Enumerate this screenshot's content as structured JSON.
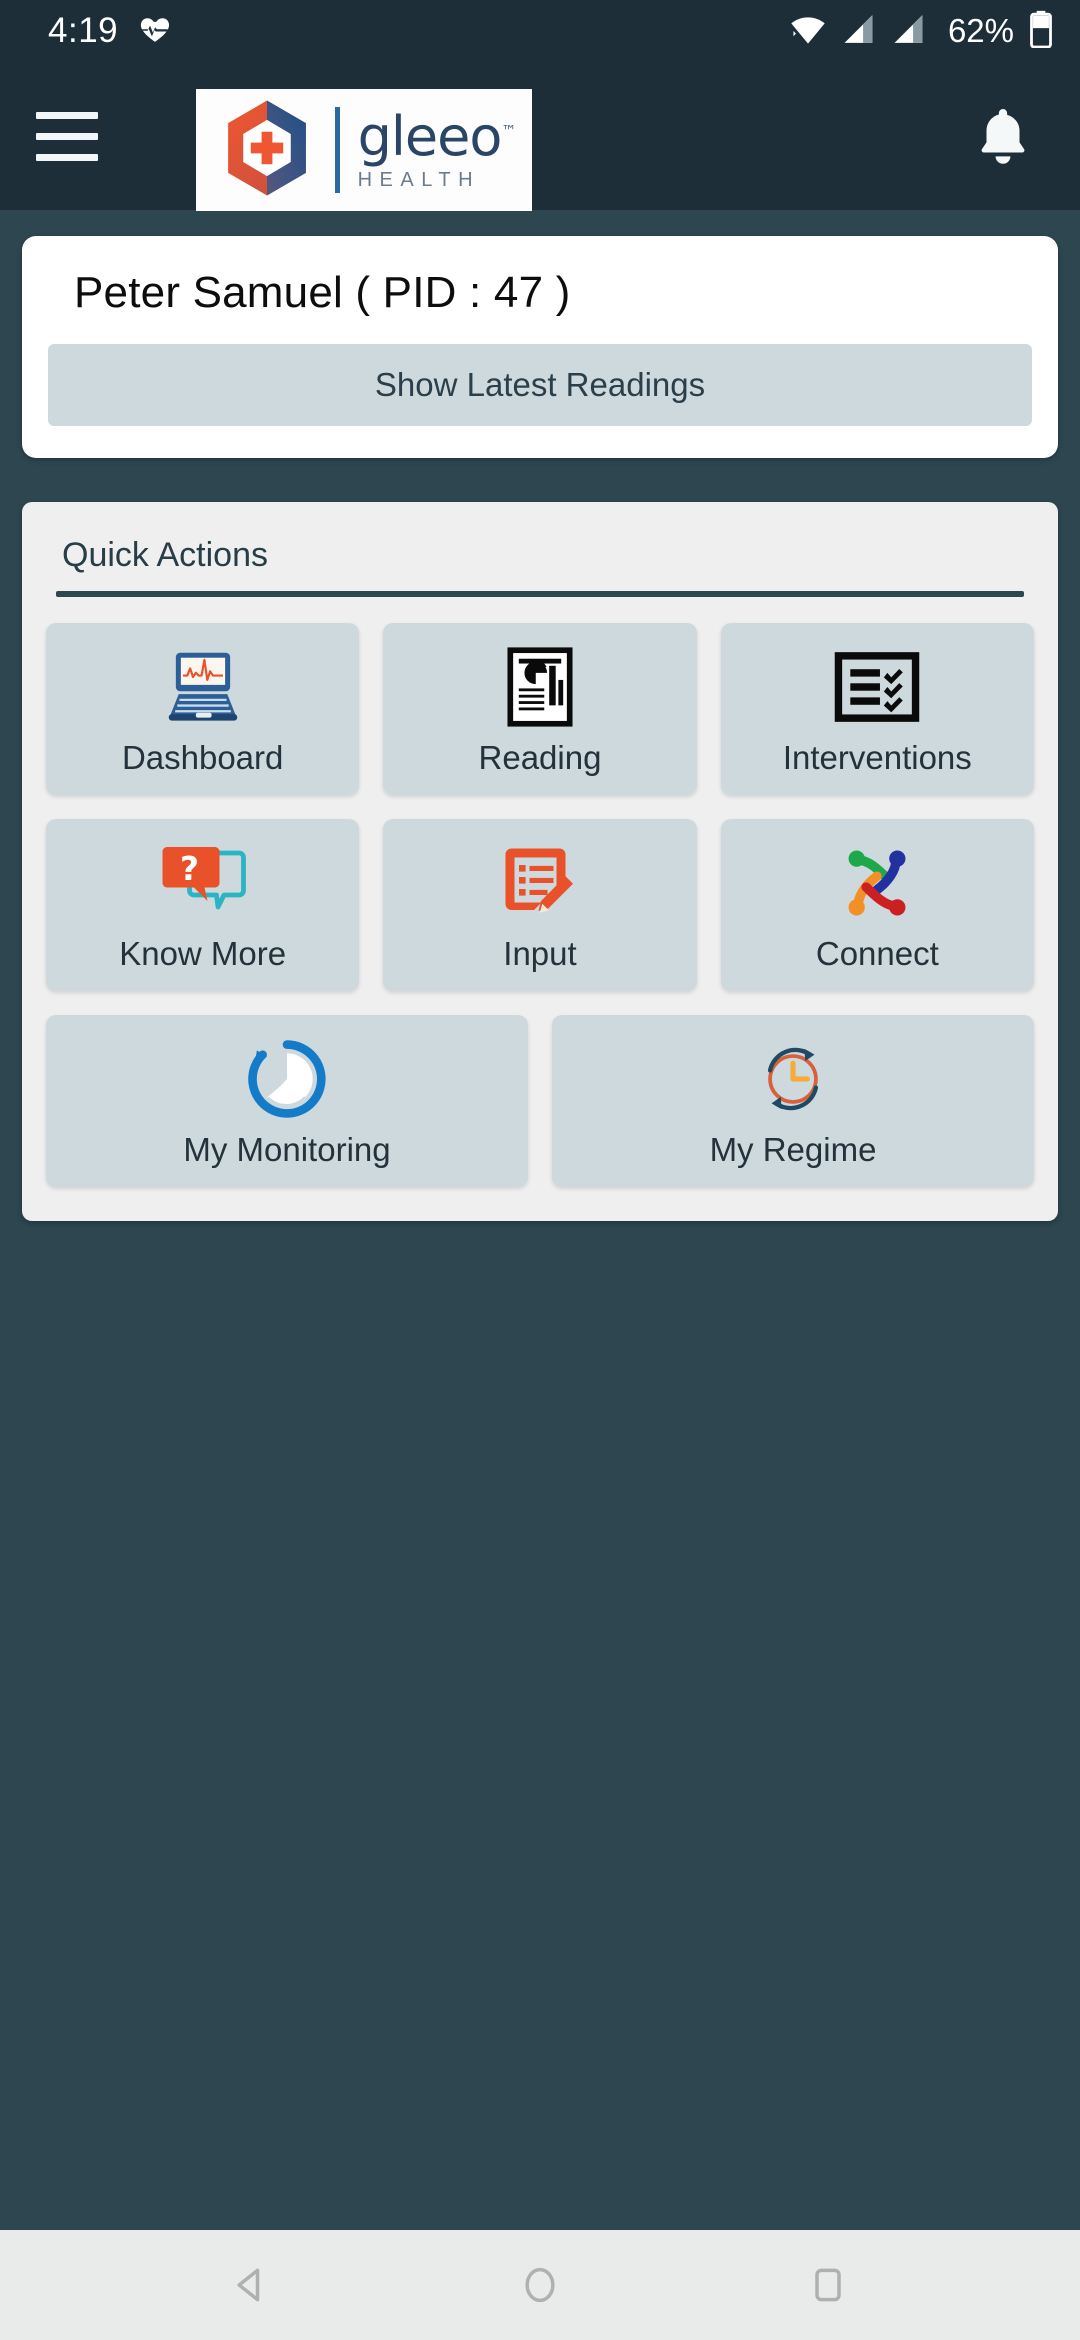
{
  "status_bar": {
    "time": "4:19",
    "health_icon": "heart-pulse-icon",
    "wifi_icon": "wifi-icon",
    "signal1_icon": "signal-bars-icon",
    "signal2_icon": "signal-bars-icon",
    "battery_percent": "62%",
    "battery_icon": "battery-icon"
  },
  "header": {
    "menu_icon": "hamburger-menu-icon",
    "logo_word": "gleeo",
    "logo_tm": "™",
    "logo_sub": "HEALTH",
    "logo_mark_icon": "gleeo-hexagon-cross-logo",
    "notifications_icon": "bell-icon"
  },
  "patient": {
    "name": "Peter  Samuel ( PID : 47 )",
    "show_readings_label": "Show Latest Readings"
  },
  "quick_actions": {
    "title": "Quick Actions",
    "tiles": [
      {
        "label": "Dashboard",
        "icon": "laptop-ecg-icon"
      },
      {
        "label": "Reading",
        "icon": "report-chart-document-icon"
      },
      {
        "label": "Interventions",
        "icon": "checklist-box-icon"
      },
      {
        "label": "Know More",
        "icon": "question-speech-bubble-icon"
      },
      {
        "label": "Input",
        "icon": "form-pencil-icon"
      },
      {
        "label": "Connect",
        "icon": "interlocking-people-knot-icon"
      },
      {
        "label": "My Monitoring",
        "icon": "circular-progress-arrow-icon"
      },
      {
        "label": "My Regime",
        "icon": "clock-refresh-icon"
      }
    ]
  },
  "nav_bar": {
    "back_icon": "back-triangle-icon",
    "home_icon": "home-circle-icon",
    "recents_icon": "recents-square-icon"
  },
  "colors": {
    "header_bg": "#1d2e38",
    "body_bg": "#2d4650",
    "tile_bg": "#ced9dd",
    "card_bg": "#efeff0",
    "accent_orange": "#e8512a",
    "accent_blue": "#2b4566"
  }
}
